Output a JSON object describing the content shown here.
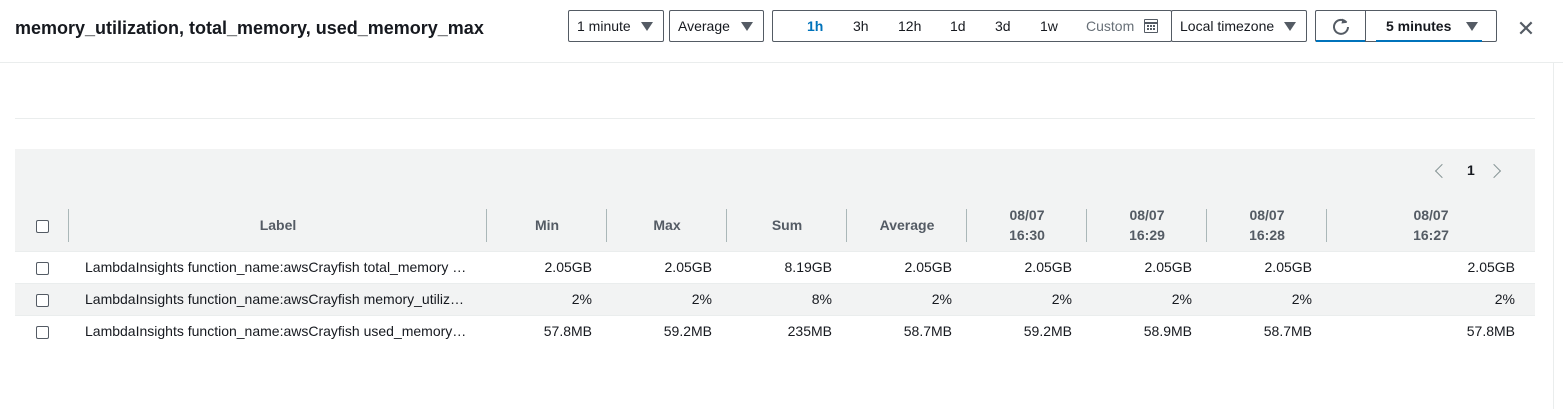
{
  "title": "memory_utilization, total_memory, used_memory_max",
  "period": {
    "selected": "1 minute"
  },
  "statistic": {
    "selected": "Average"
  },
  "time_range": {
    "options": [
      "1h",
      "3h",
      "12h",
      "1d",
      "3d",
      "1w"
    ],
    "active": "1h",
    "custom_label": "Custom"
  },
  "timezone": {
    "selected": "Local timezone"
  },
  "refresh_interval": {
    "selected": "5 minutes"
  },
  "pagination": {
    "current_page": "1"
  },
  "table": {
    "columns": {
      "label": "Label",
      "min": "Min",
      "max": "Max",
      "sum": "Sum",
      "average": "Average",
      "t1_date": "08/07",
      "t1_time": "16:30",
      "t2_date": "08/07",
      "t2_time": "16:29",
      "t3_date": "08/07",
      "t3_time": "16:28",
      "t4_date": "08/07",
      "t4_time": "16:27"
    },
    "rows": [
      {
        "label": "LambdaInsights function_name:awsCrayfish total_memory …",
        "min": "2.05GB",
        "max": "2.05GB",
        "sum": "8.19GB",
        "average": "2.05GB",
        "t1": "2.05GB",
        "t2": "2.05GB",
        "t3": "2.05GB",
        "t4": "2.05GB"
      },
      {
        "label": "LambdaInsights function_name:awsCrayfish memory_utiliz…",
        "min": "2%",
        "max": "2%",
        "sum": "8%",
        "average": "2%",
        "t1": "2%",
        "t2": "2%",
        "t3": "2%",
        "t4": "2%"
      },
      {
        "label": "LambdaInsights function_name:awsCrayfish used_memory…",
        "min": "57.8MB",
        "max": "59.2MB",
        "sum": "235MB",
        "average": "58.7MB",
        "t1": "59.2MB",
        "t2": "58.9MB",
        "t3": "58.7MB",
        "t4": "57.8MB"
      }
    ]
  },
  "colors": {
    "accent": "#0073bb",
    "text": "#16191f",
    "muted": "#545b64",
    "stripe": "#f2f3f3"
  }
}
